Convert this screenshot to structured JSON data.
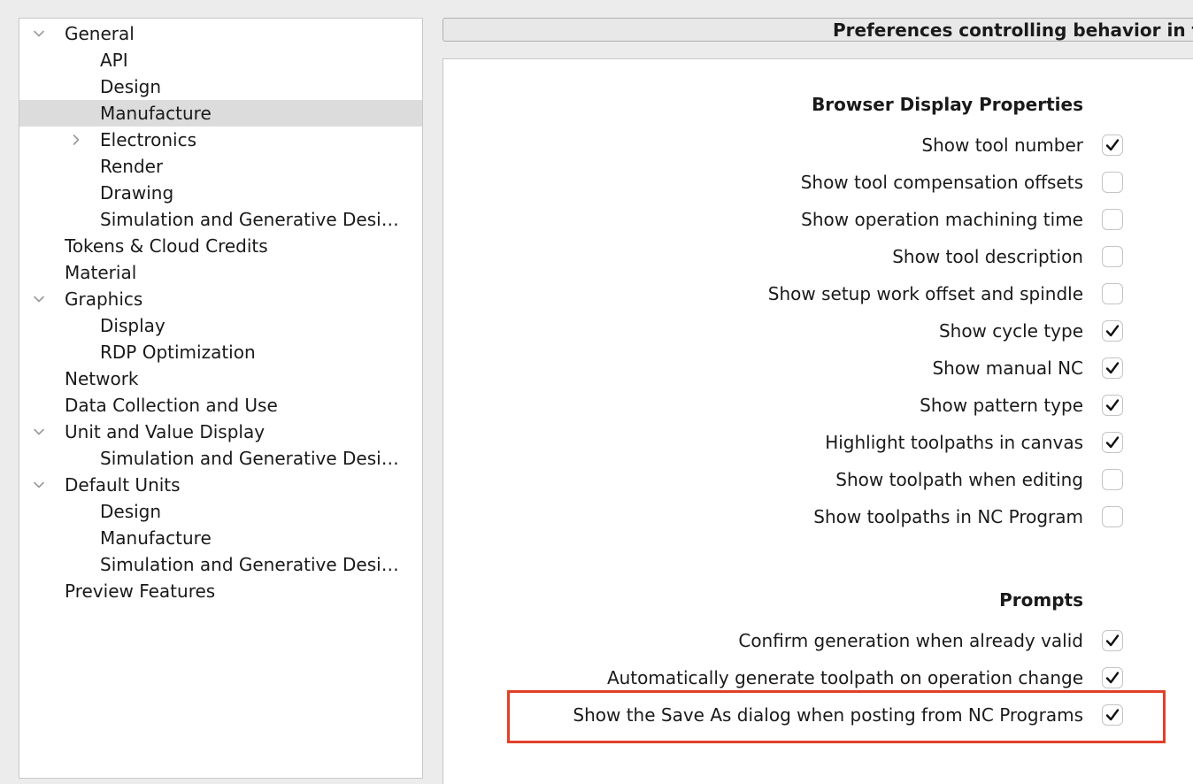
{
  "tree": [
    {
      "label": "General",
      "depth": 0,
      "twisty": "expanded"
    },
    {
      "label": "API",
      "depth": 1,
      "twisty": "none"
    },
    {
      "label": "Design",
      "depth": 1,
      "twisty": "none"
    },
    {
      "label": "Manufacture",
      "depth": 1,
      "twisty": "none",
      "selected": true
    },
    {
      "label": "Electronics",
      "depth": 1,
      "twisty": "collapsed"
    },
    {
      "label": "Render",
      "depth": 1,
      "twisty": "none"
    },
    {
      "label": "Drawing",
      "depth": 1,
      "twisty": "none"
    },
    {
      "label": "Simulation and Generative Desi…",
      "depth": 1,
      "twisty": "none"
    },
    {
      "label": "Tokens & Cloud Credits",
      "depth": 0,
      "twisty": "none"
    },
    {
      "label": "Material",
      "depth": 0,
      "twisty": "none"
    },
    {
      "label": "Graphics",
      "depth": 0,
      "twisty": "expanded"
    },
    {
      "label": "Display",
      "depth": 1,
      "twisty": "none"
    },
    {
      "label": "RDP Optimization",
      "depth": 1,
      "twisty": "none"
    },
    {
      "label": "Network",
      "depth": 0,
      "twisty": "none"
    },
    {
      "label": "Data Collection and Use",
      "depth": 0,
      "twisty": "none"
    },
    {
      "label": "Unit and Value Display",
      "depth": 0,
      "twisty": "expanded"
    },
    {
      "label": "Simulation and Generative Desi…",
      "depth": 1,
      "twisty": "none"
    },
    {
      "label": "Default Units",
      "depth": 0,
      "twisty": "expanded"
    },
    {
      "label": "Design",
      "depth": 1,
      "twisty": "none"
    },
    {
      "label": "Manufacture",
      "depth": 1,
      "twisty": "none"
    },
    {
      "label": "Simulation and Generative Desi…",
      "depth": 1,
      "twisty": "none"
    },
    {
      "label": "Preview Features",
      "depth": 0,
      "twisty": "none"
    }
  ],
  "header": {
    "title": "Preferences controlling behavior in t"
  },
  "sections": {
    "browser": {
      "heading": "Browser Display Properties",
      "items": [
        {
          "label": "Show tool number",
          "checked": true
        },
        {
          "label": "Show tool compensation offsets",
          "checked": false
        },
        {
          "label": "Show operation machining time",
          "checked": false
        },
        {
          "label": "Show tool description",
          "checked": false
        },
        {
          "label": "Show setup work offset and spindle",
          "checked": false
        },
        {
          "label": "Show cycle type",
          "checked": true
        },
        {
          "label": "Show manual NC",
          "checked": true
        },
        {
          "label": "Show pattern type",
          "checked": true
        },
        {
          "label": "Highlight toolpaths in canvas",
          "checked": true
        },
        {
          "label": "Show toolpath when editing",
          "checked": false
        },
        {
          "label": "Show toolpaths in NC Program",
          "checked": false
        }
      ]
    },
    "prompts": {
      "heading": "Prompts",
      "items": [
        {
          "label": "Confirm generation when already valid",
          "checked": true
        },
        {
          "label": "Automatically generate toolpath on operation change",
          "checked": true
        },
        {
          "label": "Show the Save As dialog when posting from NC Programs",
          "checked": true
        }
      ]
    }
  },
  "colors": {
    "highlight": "#e0402a",
    "selection": "#dcdcdc"
  }
}
